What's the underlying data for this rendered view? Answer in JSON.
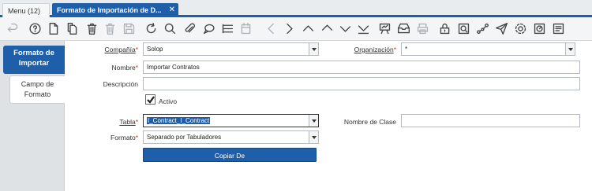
{
  "tabs": {
    "menu": "Menu (12)",
    "active": "Formato de Importación de D...",
    "close": "✕"
  },
  "toolbar": {
    "icons": [
      "undo-icon",
      "help-icon",
      "new-record-icon",
      "copy-record-icon",
      "delete-icon",
      "delete-selection-icon",
      "save-icon",
      "refresh-icon",
      "find-icon",
      "attachment-icon",
      "chat-icon",
      "grid-toggle-icon",
      "calendar-icon",
      "previous-record-icon",
      "next-record-icon",
      "parent-record-icon",
      "detail-record-icon",
      "last-record-icon",
      "report-icon",
      "archive-icon",
      "print-icon",
      "lock-icon",
      "zoom-across-icon",
      "workflow-icon",
      "send-icon",
      "settings-icon",
      "process-icon",
      "customize-icon"
    ]
  },
  "side": {
    "active_line1": "Formato de",
    "active_line2": "Importar",
    "item_line1": "Campo de",
    "item_line2": "Formato"
  },
  "form": {
    "company_label": "Compañía",
    "company_value": "Solop",
    "org_label": "Organización",
    "org_value": "*",
    "name_label": "Nombre",
    "name_value": "Importar Contratos",
    "description_label": "Descripción",
    "description_value": "",
    "active_label": "Activo",
    "table_label": "Tabla",
    "table_value": "I_Contract_I_Contract",
    "class_label": "Nombre de Clase",
    "class_value": "",
    "format_label": "Formato",
    "format_value": "Separado por Tabuladores",
    "copy_button": "Copiar De",
    "required_mark": "*"
  }
}
